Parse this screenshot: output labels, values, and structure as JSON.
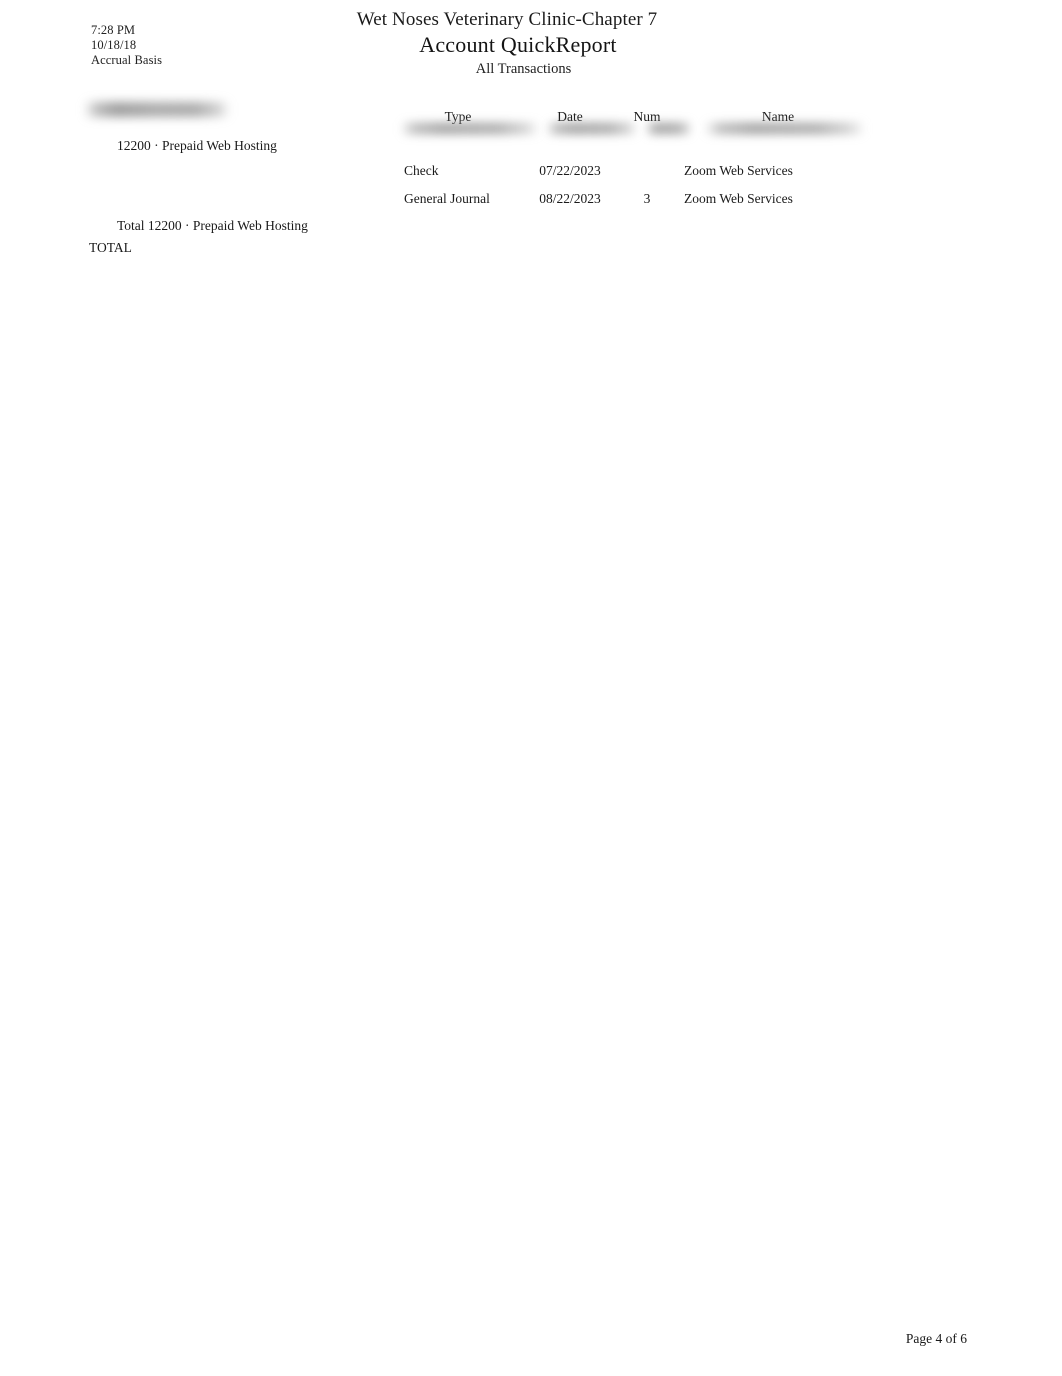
{
  "header": {
    "time": "7:28 PM",
    "date": "10/18/18",
    "basis": "Accrual Basis",
    "company_title": "Wet Noses Veterinary Clinic-Chapter 7",
    "report_title": "Account QuickReport",
    "report_subtitle": "All Transactions"
  },
  "redacted": {
    "section_header_label": "",
    "type_underline_label": "",
    "date_underline_label": "",
    "num_underline_label": "",
    "name_underline_label": ""
  },
  "account": {
    "label": "12200 · Prepaid Web Hosting",
    "total_label": "Total 12200 · Prepaid Web Hosting",
    "total_amount": "",
    "grand_total_label": "TOTAL",
    "grand_total_amount": ""
  },
  "table": {
    "columns": [
      {
        "key": "type",
        "label": "Type"
      },
      {
        "key": "date",
        "label": "Date"
      },
      {
        "key": "num",
        "label": "Num"
      },
      {
        "key": "name",
        "label": "Name"
      }
    ],
    "rows": [
      {
        "type": "Check",
        "date": "07/22/2023",
        "num": "",
        "name": "Zoom Web Services"
      },
      {
        "type": "General Journal",
        "date": "08/22/2023",
        "num": "3",
        "name": "Zoom Web Services"
      }
    ]
  },
  "footer": {
    "page_label": "Page 4 of 6"
  }
}
